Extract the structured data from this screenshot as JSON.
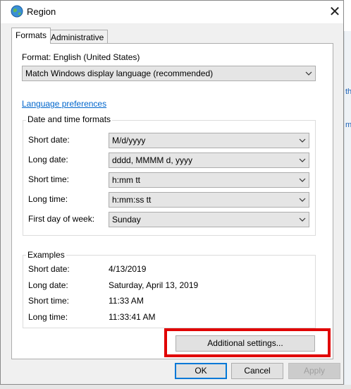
{
  "window": {
    "title": "Region",
    "close_glyph": "✕"
  },
  "tabs": [
    {
      "label": "Formats",
      "active": true
    },
    {
      "label": "Administrative",
      "active": false
    }
  ],
  "format": {
    "label": "Format: English (United States)",
    "value": "Match Windows display language (recommended)"
  },
  "language_preferences_link": "Language preferences",
  "date_time": {
    "group_title": "Date and time formats",
    "rows": [
      {
        "label": "Short date:",
        "value": "M/d/yyyy"
      },
      {
        "label": "Long date:",
        "value": "dddd, MMMM d, yyyy"
      },
      {
        "label": "Short time:",
        "value": "h:mm tt"
      },
      {
        "label": "Long time:",
        "value": "h:mm:ss tt"
      },
      {
        "label": "First day of week:",
        "value": "Sunday"
      }
    ]
  },
  "examples": {
    "group_title": "Examples",
    "rows": [
      {
        "label": "Short date:",
        "value": "4/13/2019"
      },
      {
        "label": "Long date:",
        "value": "Saturday, April 13, 2019"
      },
      {
        "label": "Short time:",
        "value": "11:33 AM"
      },
      {
        "label": "Long time:",
        "value": "11:33:41 AM"
      }
    ]
  },
  "additional_settings_label": "Additional settings...",
  "buttons": {
    "ok": "OK",
    "cancel": "Cancel",
    "apply": "Apply"
  },
  "background_fragments": [
    "th",
    "m"
  ],
  "colors": {
    "link": "#0066cc",
    "highlight": "#e00000",
    "focus": "#0078d7"
  },
  "icons": {
    "title": "globe-icon",
    "dropdown": "chevron-down-icon"
  }
}
